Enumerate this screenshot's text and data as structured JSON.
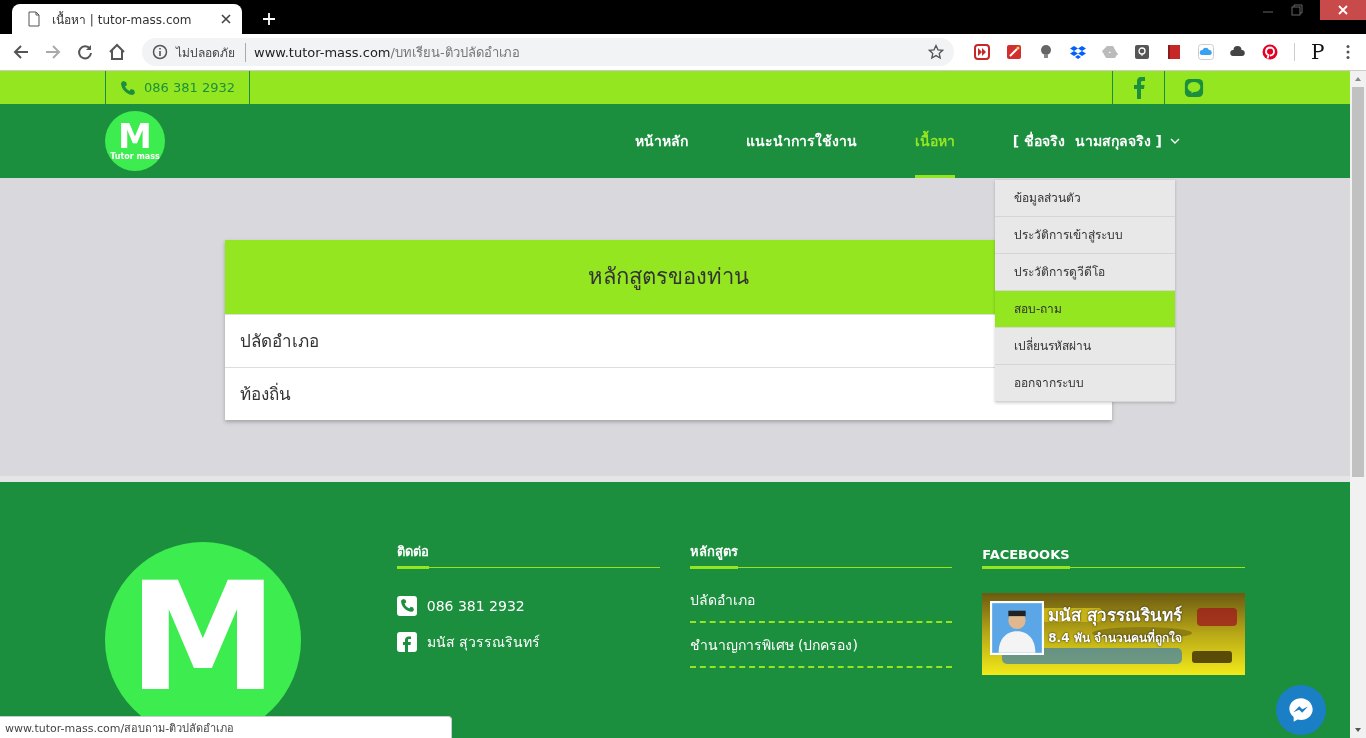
{
  "browser": {
    "tab_title": "เนื้อหา | tutor-mass.com",
    "security_label": "ไม่ปลอดภัย",
    "url_host": "www.tutor-mass.com",
    "url_path": "/บทเรียน-ติวปลัดอำเภอ",
    "extension_letter": "P"
  },
  "top_bar": {
    "phone": "086 381 2932"
  },
  "nav": {
    "logo_letter": "M",
    "logo_caption": "Tutor mass",
    "items": [
      {
        "label": "หน้าหลัก",
        "selected": false
      },
      {
        "label": "แนะนำการใช้งาน",
        "selected": false
      },
      {
        "label": "เนื้อหา",
        "selected": true
      }
    ],
    "user_menu": {
      "label": "[ ชื่อจริง  นามสกุลจริง ]",
      "expanded": true
    }
  },
  "dropdown": [
    {
      "label": "ข้อมูลส่วนตัว",
      "selected": false
    },
    {
      "label": "ประวัติการเข้าสู่ระบบ",
      "selected": false
    },
    {
      "label": "ประวัติการดูวีดีโอ",
      "selected": false
    },
    {
      "label": "สอบ-ถาม",
      "selected": true
    },
    {
      "label": "เปลี่ยนรหัสผ่าน",
      "selected": false
    },
    {
      "label": "ออกจากระบบ",
      "selected": false
    }
  ],
  "card": {
    "title": "หลักสูตรของท่าน",
    "rows": [
      "ปลัดอำเภอ",
      "ท้องถิ่น"
    ]
  },
  "footer": {
    "logo_letter": "M",
    "contact": {
      "heading": "ติดต่อ",
      "items": [
        {
          "kind": "phone",
          "text": "086 381 2932"
        },
        {
          "kind": "facebook",
          "text": "มนัส สุวรรณรินทร์"
        }
      ]
    },
    "courses": {
      "heading": "หลักสูตร",
      "items": [
        "ปลัดอำเภอ",
        "ชำนาญการพิเศษ (ปกครอง)"
      ]
    },
    "facebook": {
      "heading": "FACEBOOKS",
      "page_name": "มนัส สุวรรณรินทร์",
      "likes": "8.4 พัน จำนวนคนที่ถูกใจ"
    }
  },
  "status_url": "www.tutor-mass.com/สอบถาม-ติวปลัดอำเภอ"
}
